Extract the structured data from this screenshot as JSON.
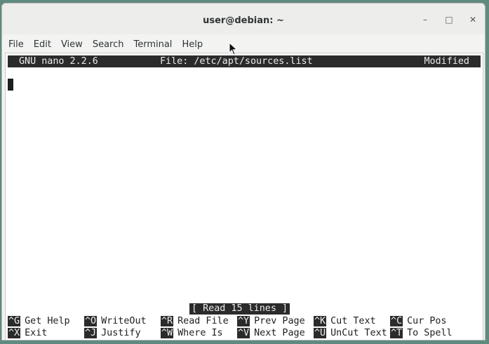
{
  "window": {
    "title": "user@debian: ~",
    "minimize_glyph": "–",
    "maximize_glyph": "□",
    "close_glyph": "✕"
  },
  "menubar": {
    "items": [
      "File",
      "Edit",
      "View",
      "Search",
      "Terminal",
      "Help"
    ]
  },
  "nano": {
    "version": "GNU nano 2.2.6",
    "file": "File: /etc/apt/sources.list",
    "state": "Modified",
    "status_message": "[ Read 15 lines ]",
    "shortcuts_row1": [
      {
        "key": "^G",
        "label": "Get Help"
      },
      {
        "key": "^O",
        "label": "WriteOut"
      },
      {
        "key": "^R",
        "label": "Read File"
      },
      {
        "key": "^Y",
        "label": "Prev Page"
      },
      {
        "key": "^K",
        "label": "Cut Text"
      },
      {
        "key": "^C",
        "label": "Cur Pos"
      }
    ],
    "shortcuts_row2": [
      {
        "key": "^X",
        "label": "Exit"
      },
      {
        "key": "^J",
        "label": "Justify"
      },
      {
        "key": "^W",
        "label": "Where Is"
      },
      {
        "key": "^V",
        "label": "Next Page"
      },
      {
        "key": "^U",
        "label": "UnCut Text"
      },
      {
        "key": "^T",
        "label": "To Spell"
      }
    ]
  },
  "colors": {
    "terminal_bg": "#ffffff",
    "bar_bg": "#2b2b2b",
    "bar_fg": "#ececec",
    "desktop_bg": "#5f8a7f"
  }
}
